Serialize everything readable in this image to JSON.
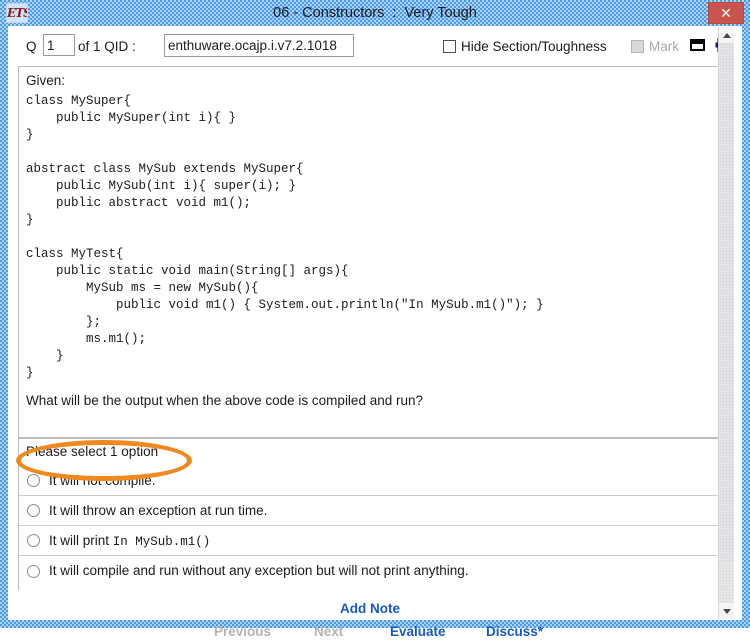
{
  "window": {
    "title": "06 - Constructors  :  Very Tough",
    "app_icon": "ets-logo-icon",
    "close_label": "✕"
  },
  "toolbar": {
    "q_label": "Q",
    "q_value": "1",
    "of_label": "of 1 QID :",
    "qid_value": "enthuware.ocajp.i.v7.2.1018",
    "hide_section_label": "Hide Section/Toughness",
    "mark_label": "Mark",
    "restore_icon": "restore-window-icon",
    "print_icon": "printer-icon"
  },
  "question": {
    "given_label": "Given:",
    "code": "class MySuper{\n    public MySuper(int i){ }\n}\n\nabstract class MySub extends MySuper{\n    public MySub(int i){ super(i); }\n    public abstract void m1();\n}\n\nclass MyTest{\n    public static void main(String[] args){\n        MySub ms = new MySub(){\n            public void m1() { System.out.println(\"In MySub.m1()\"); }\n        };\n        ms.m1();\n    }\n}",
    "prompt": "What will be the output when the above code is compiled and run?"
  },
  "answers": {
    "select_hint": "Please select 1 option",
    "options": [
      {
        "text": "It will not compile.",
        "mono": "",
        "selected": false,
        "annotated": true
      },
      {
        "text": "It will throw an exception at run time.",
        "mono": "",
        "selected": false,
        "annotated": false
      },
      {
        "text": "It will print ",
        "mono": "In MySub.m1()",
        "selected": false,
        "annotated": false
      },
      {
        "text": "It will compile and run without any exception but will not print anything.",
        "mono": "",
        "selected": false,
        "annotated": false
      }
    ]
  },
  "footer": {
    "add_note": "Add Note",
    "previous": "Previous",
    "next": "Next",
    "evaluate": "Evaluate",
    "discuss": "Discuss*"
  },
  "colors": {
    "frame_blue": "#4a9ce8",
    "link_blue": "#1559c4",
    "disabled_gray": "#b3b3b3",
    "annotation_orange": "#F08A1E",
    "close_red": "#c9544c"
  }
}
